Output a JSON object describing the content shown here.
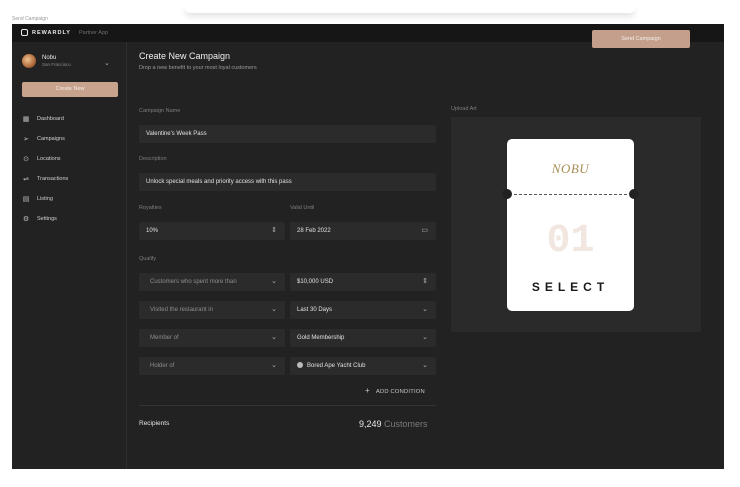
{
  "window_title": "Send Campaign",
  "appbar": {
    "brand": "REWARDLY",
    "subtitle": "Partner App"
  },
  "venue": {
    "name": "Nobu",
    "city": "San Francisco"
  },
  "sidebar": {
    "create_label": "Create New",
    "items": [
      {
        "label": "Dashboard",
        "icon": "dashboard-icon"
      },
      {
        "label": "Campaigns",
        "icon": "send-icon"
      },
      {
        "label": "Locations",
        "icon": "pin-icon"
      },
      {
        "label": "Transactions",
        "icon": "transfer-icon"
      },
      {
        "label": "Listing",
        "icon": "listing-icon"
      },
      {
        "label": "Settings",
        "icon": "gear-icon"
      }
    ]
  },
  "header": {
    "title": "Create New Campaign",
    "subtitle": "Drop a new benefit to your most loyal customers",
    "send_label": "Send Campaign"
  },
  "form": {
    "campaign_name_label": "Campaign Name",
    "campaign_name_value": "Valentine's Week Pass",
    "description_label": "Description",
    "description_value": "Unlock special meals and priority access with this pass",
    "royalties_label": "Royalties",
    "royalties_value": "10%",
    "valid_until_label": "Valid Until",
    "valid_until_value": "28 Feb 2022",
    "qualify_label": "Qualify",
    "conditions": [
      {
        "type": "Customers who spent more than",
        "value": "$10,000 USD"
      },
      {
        "type": "Visited the restaurant in",
        "value": "Last 30 Days"
      },
      {
        "type": "Member of",
        "value": "Gold Membership"
      },
      {
        "type": "Holder of",
        "value": "Bored Ape Yacht Club"
      }
    ],
    "add_condition_label": "ADD CONDITION",
    "add_condition_icon": "+"
  },
  "recipients": {
    "label": "Recipients",
    "count": "9,249",
    "unit": "Customers"
  },
  "upload": {
    "label": "Upload Art",
    "pass": {
      "brand": "NOBU",
      "number": "01",
      "tier": "SELECT"
    }
  },
  "colors": {
    "accent": "#c4a08c",
    "background": "#222222",
    "sidebar_bg": "#161616"
  }
}
